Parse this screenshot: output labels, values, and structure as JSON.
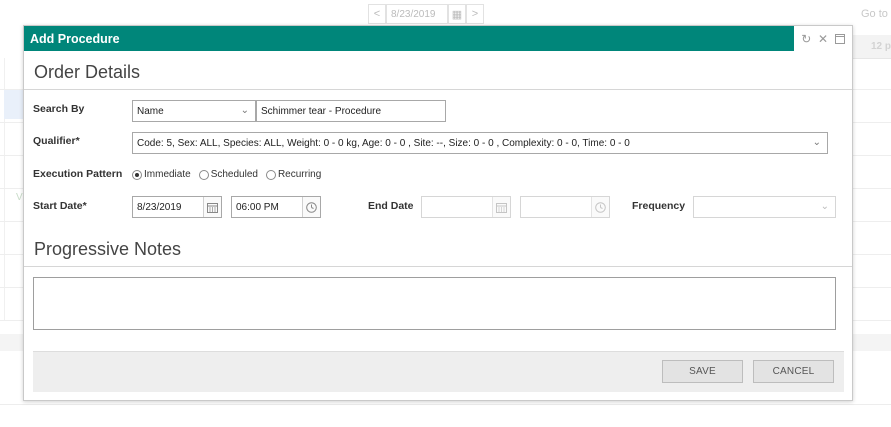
{
  "background": {
    "prev_label": "<",
    "date": "8/23/2019",
    "next_label": ">",
    "goto_label": "Go to",
    "time_header": "12 p",
    "left_marker": "V"
  },
  "dialog": {
    "title": "Add Procedure",
    "accent_color": "#00867a",
    "icons": [
      "refresh-icon",
      "close-icon",
      "maximize-icon"
    ]
  },
  "order_details": {
    "section_title": "Order Details",
    "search_by": {
      "label": "Search By",
      "type_value": "Name",
      "search_value": "Schimmer tear - Procedure"
    },
    "qualifier": {
      "label": "Qualifier*",
      "value": "Code: 5, Sex: ALL, Species: ALL, Weight: 0 -  0 kg, Age: 0 -  0 , Site: --, Size: 0 -  0 , Complexity: 0 - 0, Time: 0 -  0"
    },
    "execution_pattern": {
      "label": "Execution Pattern",
      "options": [
        "Immediate",
        "Scheduled",
        "Recurring"
      ],
      "selected": "Immediate"
    },
    "start_date": {
      "label": "Start Date*",
      "date_value": "8/23/2019",
      "time_value": "06:00 PM"
    },
    "end_date": {
      "label": "End Date",
      "date_value": "",
      "time_value": ""
    },
    "frequency": {
      "label": "Frequency",
      "value": ""
    }
  },
  "progressive_notes": {
    "section_title": "Progressive Notes",
    "value": ""
  },
  "footer": {
    "save_label": "SAVE",
    "cancel_label": "CANCEL"
  }
}
